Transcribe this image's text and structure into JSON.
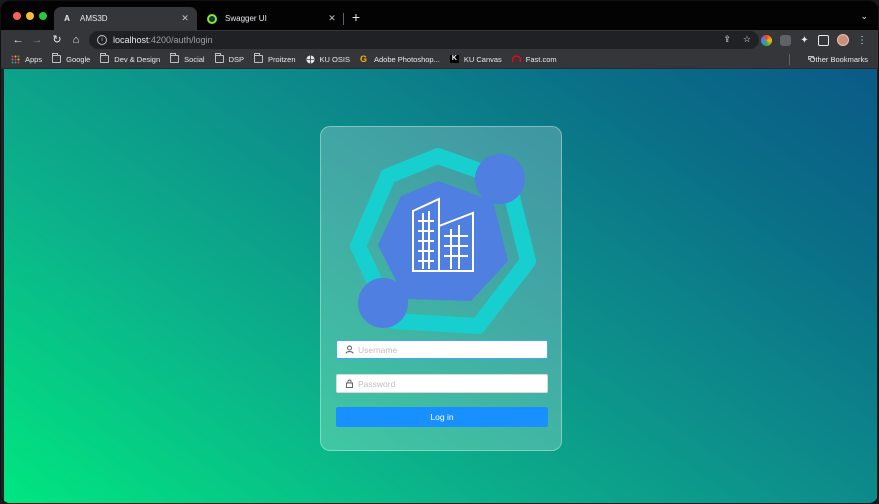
{
  "browser": {
    "tabs": [
      {
        "title": "AMS3D",
        "favicon": "A",
        "active": true
      },
      {
        "title": "Swagger UI",
        "favicon": "swagger-icon",
        "active": false
      }
    ],
    "new_tab": "+",
    "address": {
      "host": "localhost",
      "path": ":4200/auth/login"
    },
    "bookmarks": [
      {
        "label": "Apps",
        "icon": "apps-grid-icon"
      },
      {
        "label": "Google",
        "icon": "folder-icon"
      },
      {
        "label": "Dev & Design",
        "icon": "folder-icon"
      },
      {
        "label": "Social",
        "icon": "folder-icon"
      },
      {
        "label": "DSP",
        "icon": "folder-icon"
      },
      {
        "label": "Proitzen",
        "icon": "folder-icon"
      },
      {
        "label": "KU OSIS",
        "icon": "globe-icon"
      },
      {
        "label": "Adobe Photoshop...",
        "icon": "g-logo-icon"
      },
      {
        "label": "KU Canvas",
        "icon": "k-logo-icon"
      },
      {
        "label": "Fast.com",
        "icon": "fast-logo-icon"
      }
    ],
    "other_bookmarks": "Other Bookmarks"
  },
  "login": {
    "username_placeholder": "Username",
    "password_placeholder": "Password",
    "button_label": "Log in"
  },
  "colors": {
    "primary": "#1890ff",
    "logo_teal": "#17cfcf",
    "logo_blue": "#4f7fe0"
  }
}
